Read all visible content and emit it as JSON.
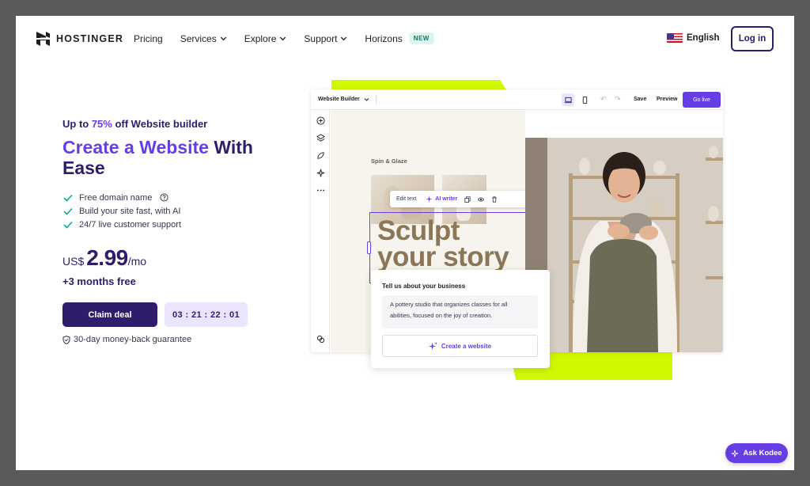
{
  "header": {
    "brand": "HOSTINGER",
    "menu": [
      {
        "label": "Pricing"
      },
      {
        "label": "Services"
      },
      {
        "label": "Explore"
      },
      {
        "label": "Support"
      },
      {
        "label": "Horizons"
      }
    ],
    "new_badge": "NEW",
    "language": "English",
    "login": "Log in"
  },
  "hero": {
    "promo_prefix": "Up to ",
    "promo_accent": "75%",
    "promo_suffix": " off Website builder",
    "headline_accent": "Create a Website",
    "headline_rest": " With Ease",
    "features": [
      {
        "text": "Free domain name"
      },
      {
        "text": "Build your site fast, with AI"
      },
      {
        "text": "24/7 live customer support"
      }
    ],
    "currency": "US$",
    "price": "2.99",
    "per": "/mo",
    "bonus": "+3 months free",
    "claim": "Claim deal",
    "timer": "03 : 21 : 22 : 01",
    "guarantee": "30-day money-back guarantee"
  },
  "builder": {
    "title": "Website Builder",
    "save": "Save",
    "preview": "Preview",
    "go_live": "Go live",
    "brand": "Spin & Glaze",
    "toolbar_edit": "Edit text",
    "toolbar_ai": "AI writer",
    "heading_line1": "Sculpt",
    "heading_line2": "your story",
    "card_question": "Tell us about your business",
    "card_text": "A pottery studio that organizes classes for all abilities, focused on the joy of creation.",
    "card_button": "Create a website"
  },
  "chat": {
    "label": "Ask Kodee"
  },
  "colors": {
    "brand_dark": "#2f1c6a",
    "brand_purple": "#673de6",
    "lime": "#d2f800",
    "check_green": "#00b090"
  }
}
